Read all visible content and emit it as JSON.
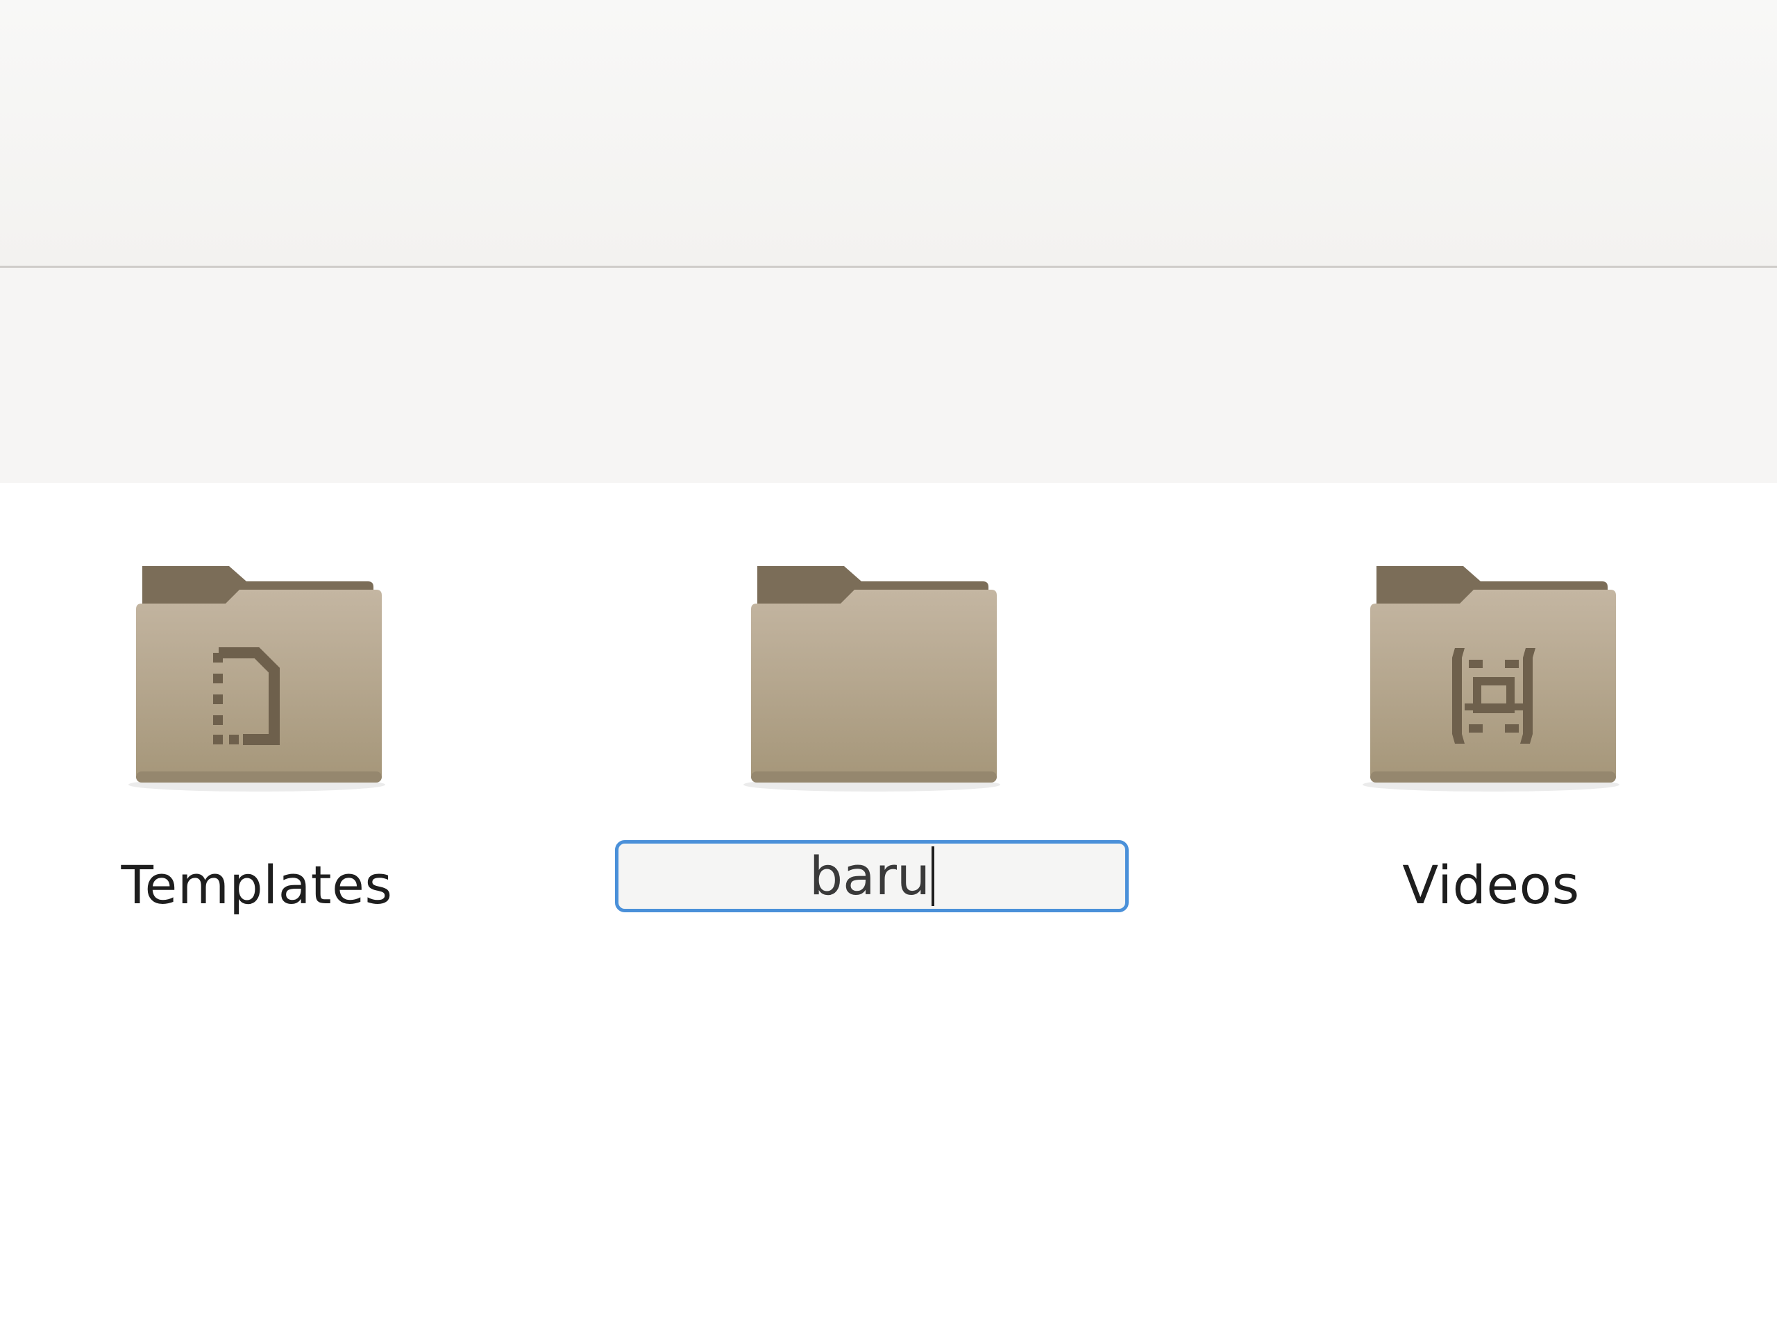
{
  "files": {
    "items": [
      {
        "name": "Templates",
        "icon": "templates-folder-icon"
      },
      {
        "name": "baru",
        "icon": "folder-icon",
        "renaming": true
      },
      {
        "name": "Videos",
        "icon": "videos-folder-icon"
      }
    ]
  },
  "colors": {
    "folder_back": "#7e705c",
    "folder_front_top": "#c2b4a0",
    "folder_front_bottom": "#a8997f",
    "folder_emblem": "#6e604c",
    "focus_border": "#4a90d9"
  }
}
